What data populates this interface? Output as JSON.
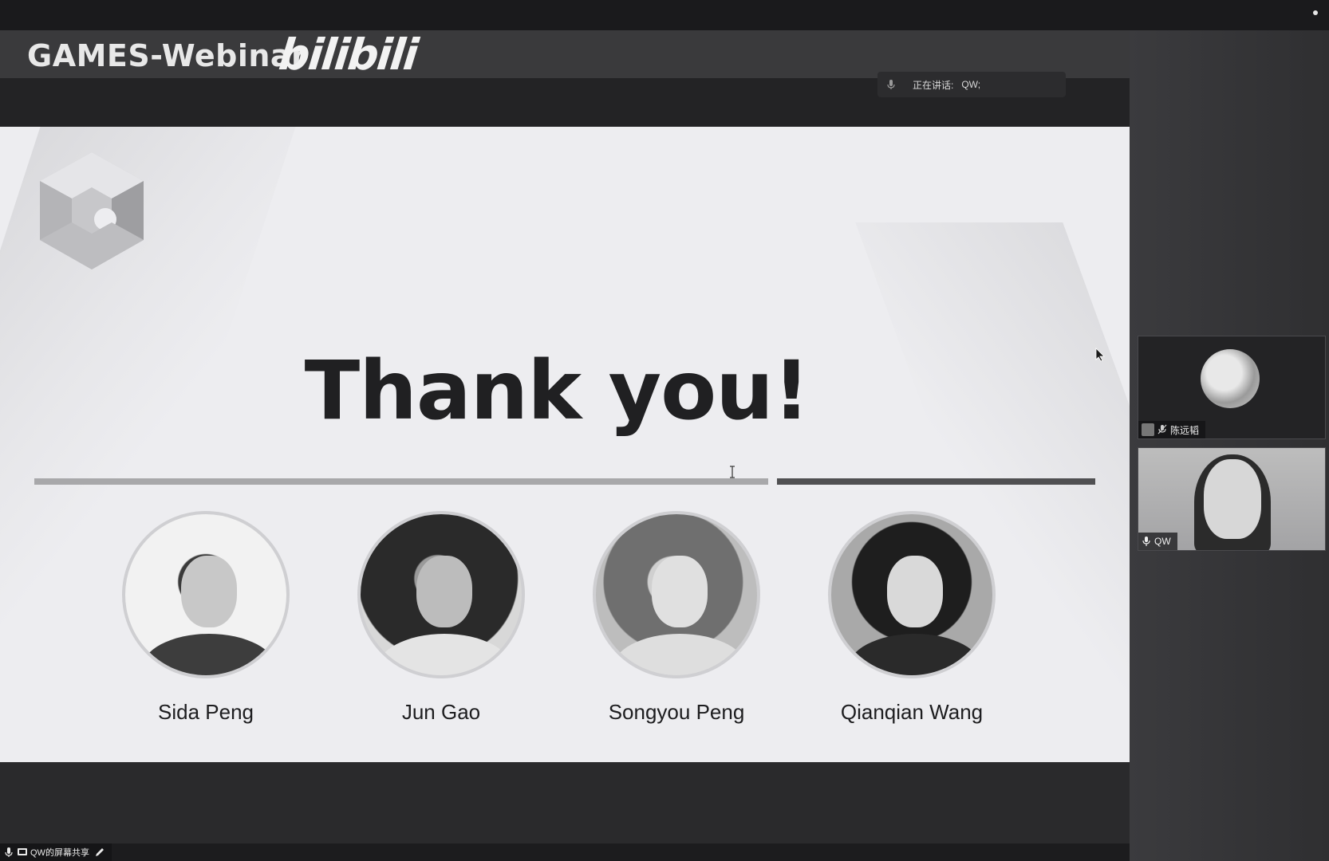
{
  "header": {
    "brand_title": "GAMES-Webinar",
    "bilibili_logo_text": "bilibili"
  },
  "speaking_indicator": {
    "label": "正在讲话:",
    "speaker": "QW;"
  },
  "slide": {
    "title": "Thank you!",
    "presenters": [
      {
        "name": "Sida Peng"
      },
      {
        "name": "Jun Gao"
      },
      {
        "name": "Songyou Peng"
      },
      {
        "name": "Qianqian Wang"
      }
    ]
  },
  "video_tiles": [
    {
      "name": "陈远韬",
      "muted": true
    },
    {
      "name": "QW",
      "muted": false
    }
  ],
  "screen_share_tag": {
    "label": "QW的屏幕共享"
  },
  "icons": {
    "mic": "microphone-icon",
    "screen": "screen-share-icon",
    "edit": "pencil-icon",
    "user": "user-avatar-icon"
  }
}
